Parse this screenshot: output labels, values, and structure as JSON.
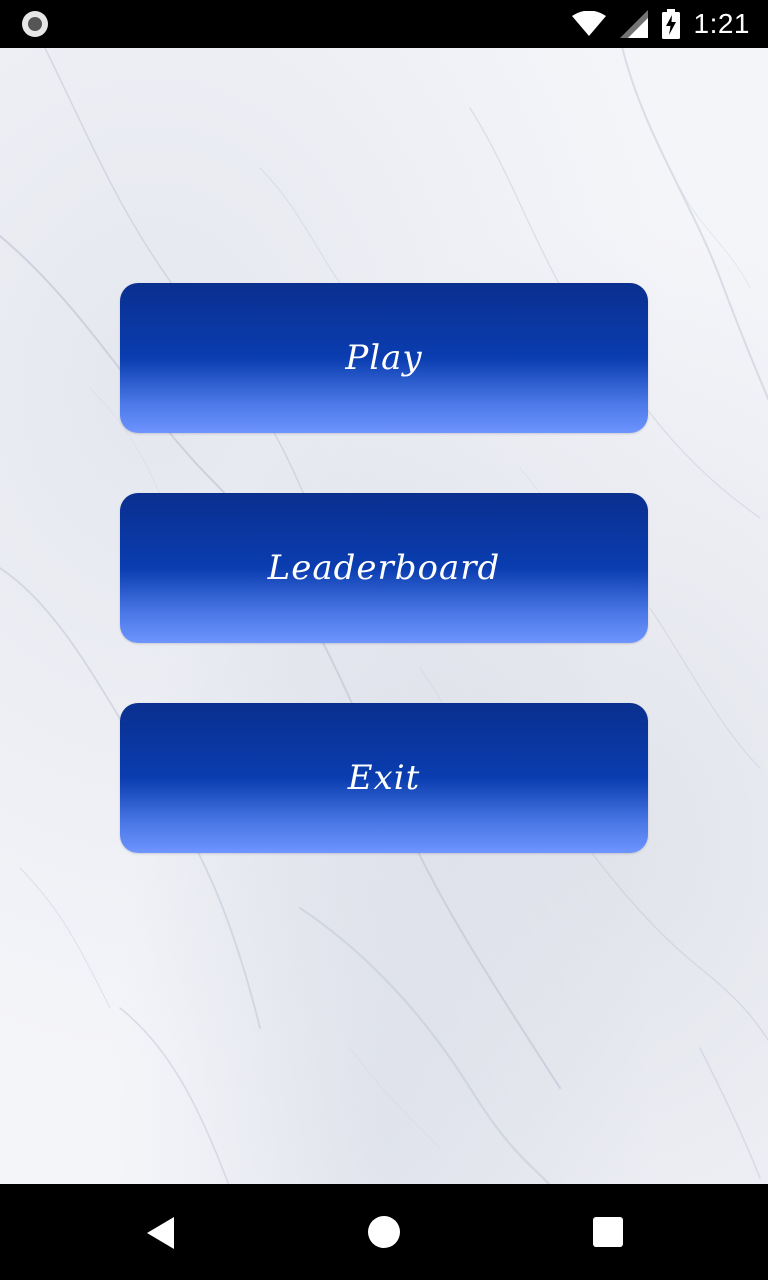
{
  "status_bar": {
    "time": "1:21",
    "left_icon": "record-icon",
    "icons": [
      "wifi-icon",
      "signal-icon",
      "battery-charging-icon"
    ]
  },
  "menu": {
    "buttons": [
      {
        "label": "Play"
      },
      {
        "label": "Leaderboard"
      },
      {
        "label": "Exit"
      }
    ]
  },
  "nav_bar": {
    "icons": [
      "back-icon",
      "home-icon",
      "recent-apps-icon"
    ]
  },
  "colors": {
    "button_top": "#0a2f8f",
    "button_mid": "#0a3db0",
    "button_bottom": "#6e94ff",
    "background": "#f4f5f9"
  }
}
